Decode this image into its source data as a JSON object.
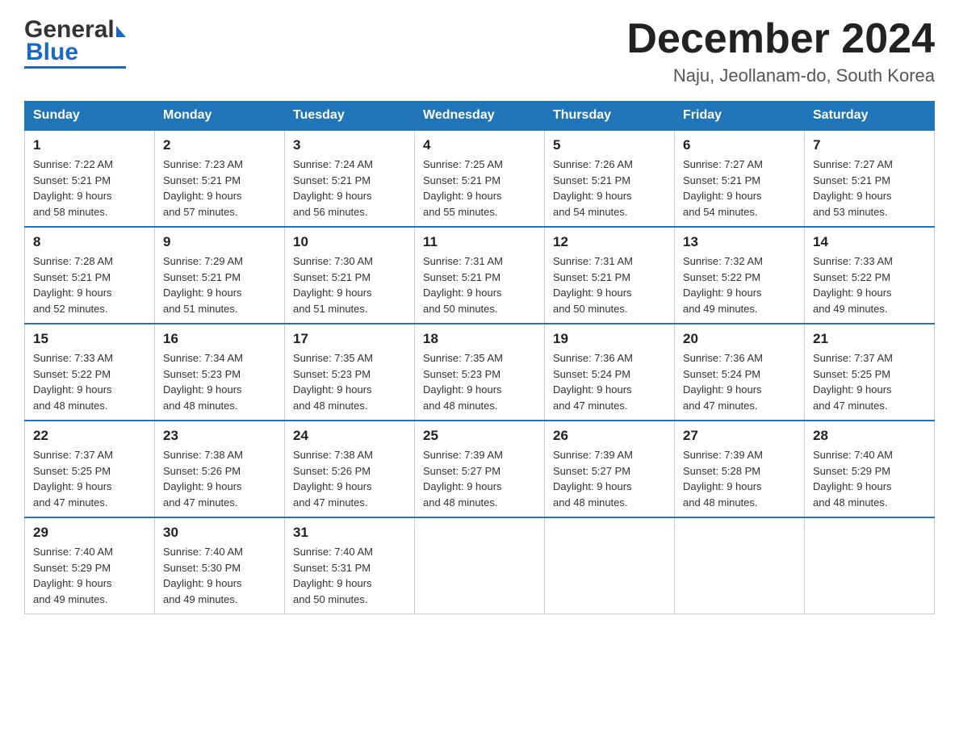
{
  "logo": {
    "general": "General",
    "blue": "Blue"
  },
  "header": {
    "month": "December 2024",
    "location": "Naju, Jeollanam-do, South Korea"
  },
  "days_of_week": [
    "Sunday",
    "Monday",
    "Tuesday",
    "Wednesday",
    "Thursday",
    "Friday",
    "Saturday"
  ],
  "weeks": [
    [
      {
        "day": "1",
        "sunrise": "7:22 AM",
        "sunset": "5:21 PM",
        "daylight": "9 hours and 58 minutes."
      },
      {
        "day": "2",
        "sunrise": "7:23 AM",
        "sunset": "5:21 PM",
        "daylight": "9 hours and 57 minutes."
      },
      {
        "day": "3",
        "sunrise": "7:24 AM",
        "sunset": "5:21 PM",
        "daylight": "9 hours and 56 minutes."
      },
      {
        "day": "4",
        "sunrise": "7:25 AM",
        "sunset": "5:21 PM",
        "daylight": "9 hours and 55 minutes."
      },
      {
        "day": "5",
        "sunrise": "7:26 AM",
        "sunset": "5:21 PM",
        "daylight": "9 hours and 54 minutes."
      },
      {
        "day": "6",
        "sunrise": "7:27 AM",
        "sunset": "5:21 PM",
        "daylight": "9 hours and 54 minutes."
      },
      {
        "day": "7",
        "sunrise": "7:27 AM",
        "sunset": "5:21 PM",
        "daylight": "9 hours and 53 minutes."
      }
    ],
    [
      {
        "day": "8",
        "sunrise": "7:28 AM",
        "sunset": "5:21 PM",
        "daylight": "9 hours and 52 minutes."
      },
      {
        "day": "9",
        "sunrise": "7:29 AM",
        "sunset": "5:21 PM",
        "daylight": "9 hours and 51 minutes."
      },
      {
        "day": "10",
        "sunrise": "7:30 AM",
        "sunset": "5:21 PM",
        "daylight": "9 hours and 51 minutes."
      },
      {
        "day": "11",
        "sunrise": "7:31 AM",
        "sunset": "5:21 PM",
        "daylight": "9 hours and 50 minutes."
      },
      {
        "day": "12",
        "sunrise": "7:31 AM",
        "sunset": "5:21 PM",
        "daylight": "9 hours and 50 minutes."
      },
      {
        "day": "13",
        "sunrise": "7:32 AM",
        "sunset": "5:22 PM",
        "daylight": "9 hours and 49 minutes."
      },
      {
        "day": "14",
        "sunrise": "7:33 AM",
        "sunset": "5:22 PM",
        "daylight": "9 hours and 49 minutes."
      }
    ],
    [
      {
        "day": "15",
        "sunrise": "7:33 AM",
        "sunset": "5:22 PM",
        "daylight": "9 hours and 48 minutes."
      },
      {
        "day": "16",
        "sunrise": "7:34 AM",
        "sunset": "5:23 PM",
        "daylight": "9 hours and 48 minutes."
      },
      {
        "day": "17",
        "sunrise": "7:35 AM",
        "sunset": "5:23 PM",
        "daylight": "9 hours and 48 minutes."
      },
      {
        "day": "18",
        "sunrise": "7:35 AM",
        "sunset": "5:23 PM",
        "daylight": "9 hours and 48 minutes."
      },
      {
        "day": "19",
        "sunrise": "7:36 AM",
        "sunset": "5:24 PM",
        "daylight": "9 hours and 47 minutes."
      },
      {
        "day": "20",
        "sunrise": "7:36 AM",
        "sunset": "5:24 PM",
        "daylight": "9 hours and 47 minutes."
      },
      {
        "day": "21",
        "sunrise": "7:37 AM",
        "sunset": "5:25 PM",
        "daylight": "9 hours and 47 minutes."
      }
    ],
    [
      {
        "day": "22",
        "sunrise": "7:37 AM",
        "sunset": "5:25 PM",
        "daylight": "9 hours and 47 minutes."
      },
      {
        "day": "23",
        "sunrise": "7:38 AM",
        "sunset": "5:26 PM",
        "daylight": "9 hours and 47 minutes."
      },
      {
        "day": "24",
        "sunrise": "7:38 AM",
        "sunset": "5:26 PM",
        "daylight": "9 hours and 47 minutes."
      },
      {
        "day": "25",
        "sunrise": "7:39 AM",
        "sunset": "5:27 PM",
        "daylight": "9 hours and 48 minutes."
      },
      {
        "day": "26",
        "sunrise": "7:39 AM",
        "sunset": "5:27 PM",
        "daylight": "9 hours and 48 minutes."
      },
      {
        "day": "27",
        "sunrise": "7:39 AM",
        "sunset": "5:28 PM",
        "daylight": "9 hours and 48 minutes."
      },
      {
        "day": "28",
        "sunrise": "7:40 AM",
        "sunset": "5:29 PM",
        "daylight": "9 hours and 48 minutes."
      }
    ],
    [
      {
        "day": "29",
        "sunrise": "7:40 AM",
        "sunset": "5:29 PM",
        "daylight": "9 hours and 49 minutes."
      },
      {
        "day": "30",
        "sunrise": "7:40 AM",
        "sunset": "5:30 PM",
        "daylight": "9 hours and 49 minutes."
      },
      {
        "day": "31",
        "sunrise": "7:40 AM",
        "sunset": "5:31 PM",
        "daylight": "9 hours and 50 minutes."
      },
      null,
      null,
      null,
      null
    ]
  ],
  "labels": {
    "sunrise": "Sunrise:",
    "sunset": "Sunset:",
    "daylight": "Daylight:"
  }
}
